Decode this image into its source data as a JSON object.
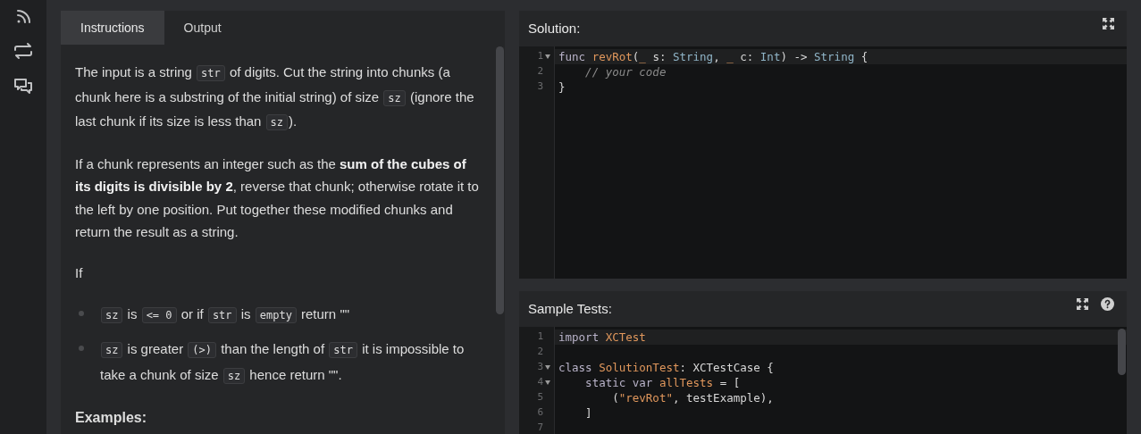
{
  "sidebar": {
    "items": [
      {
        "kind": "feed"
      },
      {
        "kind": "repeat"
      },
      {
        "kind": "chat"
      }
    ]
  },
  "instructions_panel": {
    "tabs": [
      {
        "label": "Instructions",
        "selected": true
      },
      {
        "label": "Output",
        "selected": false
      }
    ],
    "blocks": [
      {
        "kind": "paragraph",
        "segments": [
          {
            "kind": "text",
            "text": "The input is a string "
          },
          {
            "kind": "code",
            "text": "str"
          },
          {
            "kind": "text",
            "text": " of digits. Cut the string into chunks (a chunk here is a substring of the initial string) of size "
          },
          {
            "kind": "code",
            "text": "sz"
          },
          {
            "kind": "text",
            "text": " (ignore the last chunk if its size is less than "
          },
          {
            "kind": "code",
            "text": "sz"
          },
          {
            "kind": "text",
            "text": ")."
          }
        ]
      },
      {
        "kind": "paragraph",
        "segments": [
          {
            "kind": "text",
            "text": "If a chunk represents an integer such as the "
          },
          {
            "kind": "bold",
            "text": "sum of the cubes of its digits is divisible by 2"
          },
          {
            "kind": "text",
            "text": ", reverse that chunk; otherwise rotate it to the left by one position. Put together these modified chunks and return the result as a string."
          }
        ]
      },
      {
        "kind": "paragraph",
        "segments": [
          {
            "kind": "text",
            "text": "If"
          }
        ]
      },
      {
        "kind": "list",
        "items": [
          [
            {
              "kind": "code",
              "text": "sz"
            },
            {
              "kind": "text",
              "text": " is "
            },
            {
              "kind": "code",
              "text": "<= 0"
            },
            {
              "kind": "text",
              "text": " or if "
            },
            {
              "kind": "code",
              "text": "str"
            },
            {
              "kind": "text",
              "text": " is "
            },
            {
              "kind": "code",
              "text": "empty"
            },
            {
              "kind": "text",
              "text": " return \"\""
            }
          ],
          [
            {
              "kind": "code",
              "text": "sz"
            },
            {
              "kind": "text",
              "text": " is greater "
            },
            {
              "kind": "code",
              "text": "(>)"
            },
            {
              "kind": "text",
              "text": " than the length of "
            },
            {
              "kind": "code",
              "text": "str"
            },
            {
              "kind": "text",
              "text": " it is impossible to take a chunk of size "
            },
            {
              "kind": "code",
              "text": "sz"
            },
            {
              "kind": "text",
              "text": " hence return \"\"."
            }
          ]
        ]
      },
      {
        "kind": "heading",
        "segments": [
          {
            "kind": "text",
            "text": "Examples:"
          }
        ]
      }
    ]
  },
  "solution": {
    "title": "Solution:",
    "lines": [
      {
        "number": "1",
        "fold": true,
        "current": true,
        "tokens": [
          {
            "kind": "keyword",
            "text": "func "
          },
          {
            "kind": "function",
            "text": "revRot"
          },
          {
            "kind": "plain",
            "text": "("
          },
          {
            "kind": "param",
            "text": "_"
          },
          {
            "kind": "plain",
            "text": " s: "
          },
          {
            "kind": "type",
            "text": "String"
          },
          {
            "kind": "plain",
            "text": ", "
          },
          {
            "kind": "param",
            "text": "_"
          },
          {
            "kind": "plain",
            "text": " c: "
          },
          {
            "kind": "type",
            "text": "Int"
          },
          {
            "kind": "plain",
            "text": ") -> "
          },
          {
            "kind": "type",
            "text": "String"
          },
          {
            "kind": "plain",
            "text": " {"
          }
        ]
      },
      {
        "number": "2",
        "fold": false,
        "current": false,
        "tokens": [
          {
            "kind": "comment",
            "text": "    // your code"
          }
        ]
      },
      {
        "number": "3",
        "fold": false,
        "current": false,
        "tokens": [
          {
            "kind": "plain",
            "text": "}"
          }
        ]
      }
    ]
  },
  "sample_tests": {
    "title": "Sample Tests:",
    "lines": [
      {
        "number": "1",
        "fold": false,
        "current": true,
        "tokens": [
          {
            "kind": "keyword",
            "text": "import "
          },
          {
            "kind": "function",
            "text": "XCTest"
          }
        ]
      },
      {
        "number": "2",
        "fold": false,
        "current": false
      },
      {
        "number": "3",
        "fold": true,
        "current": false,
        "tokens": [
          {
            "kind": "keyword",
            "text": "class "
          },
          {
            "kind": "function",
            "text": "SolutionTest"
          },
          {
            "kind": "plain",
            "text": ": XCTestCase {"
          }
        ]
      },
      {
        "number": "4",
        "fold": true,
        "current": false,
        "tokens": [
          {
            "kind": "keyword",
            "text": "    static var "
          },
          {
            "kind": "function",
            "text": "allTests"
          },
          {
            "kind": "plain",
            "text": " = ["
          }
        ]
      },
      {
        "number": "5",
        "fold": false,
        "current": false,
        "tokens": [
          {
            "kind": "plain",
            "text": "        ("
          },
          {
            "kind": "string",
            "text": "\"revRot\""
          },
          {
            "kind": "plain",
            "text": ", testExample),"
          }
        ]
      },
      {
        "number": "6",
        "fold": false,
        "current": false,
        "tokens": [
          {
            "kind": "plain",
            "text": "    ]"
          }
        ]
      },
      {
        "number": "7",
        "fold": false,
        "current": false
      }
    ]
  }
}
